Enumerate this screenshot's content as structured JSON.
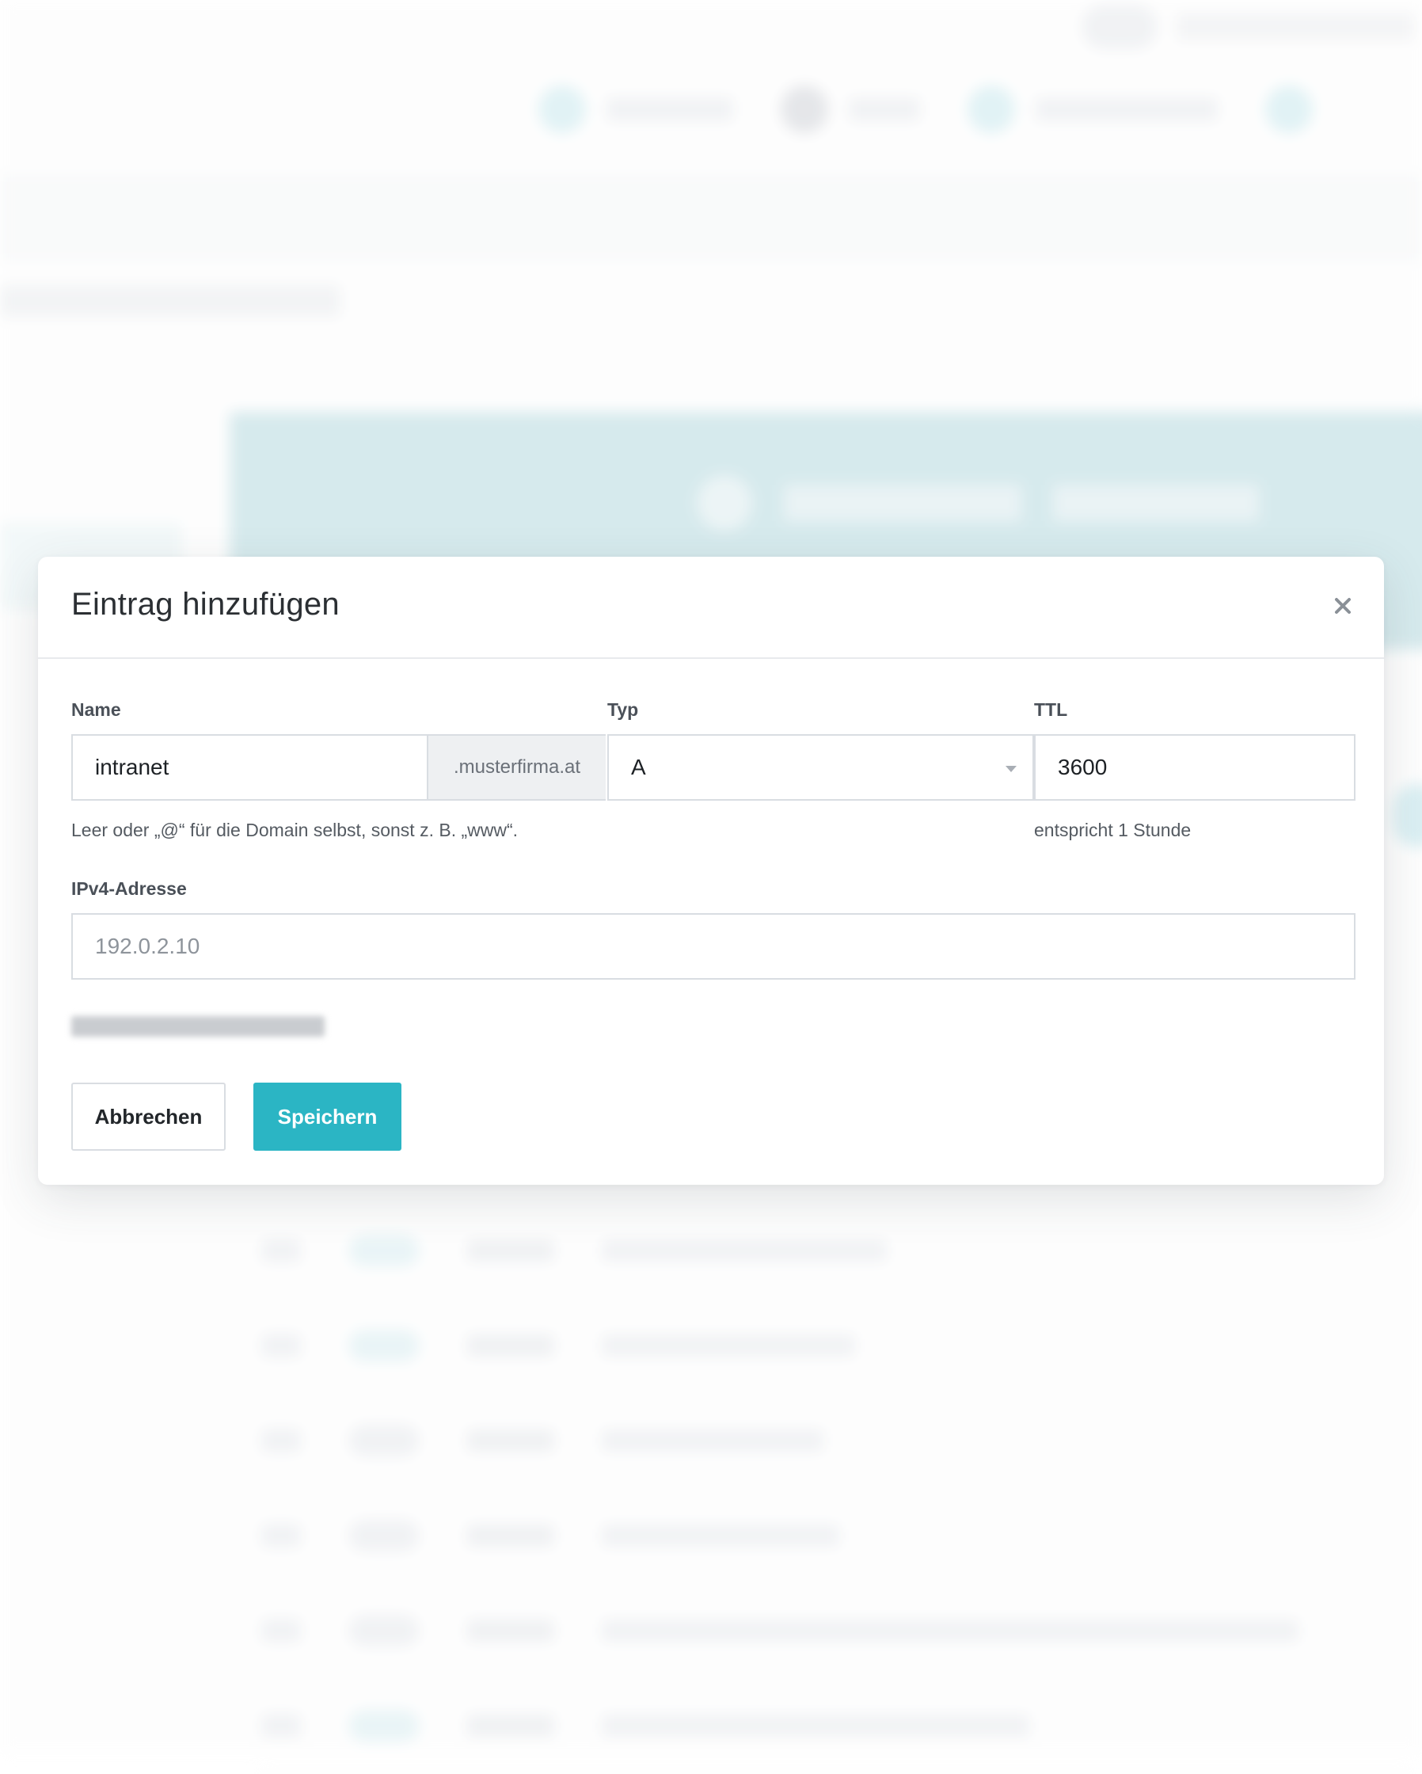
{
  "dialog": {
    "title": "Eintrag hinzufügen",
    "close_icon": "close-icon"
  },
  "form": {
    "name": {
      "label": "Name",
      "value": "intranet",
      "suffix": ".musterfirma.at",
      "help": "Leer oder „@“ für die Domain selbst, sonst z. B. „www“."
    },
    "type": {
      "label": "Typ",
      "selected": "A",
      "icon": "chevron-down-icon"
    },
    "ttl": {
      "label": "TTL",
      "value": "3600",
      "help": "entspricht 1 Stunde"
    },
    "ipv4": {
      "label": "IPv4-Adresse",
      "placeholder": "192.0.2.10",
      "value": ""
    }
  },
  "buttons": {
    "cancel": "Abbrechen",
    "save": "Speichern"
  },
  "colors": {
    "primary": "#2bb5c4",
    "border": "#d9dde2",
    "addon_bg": "#eef0f2"
  }
}
